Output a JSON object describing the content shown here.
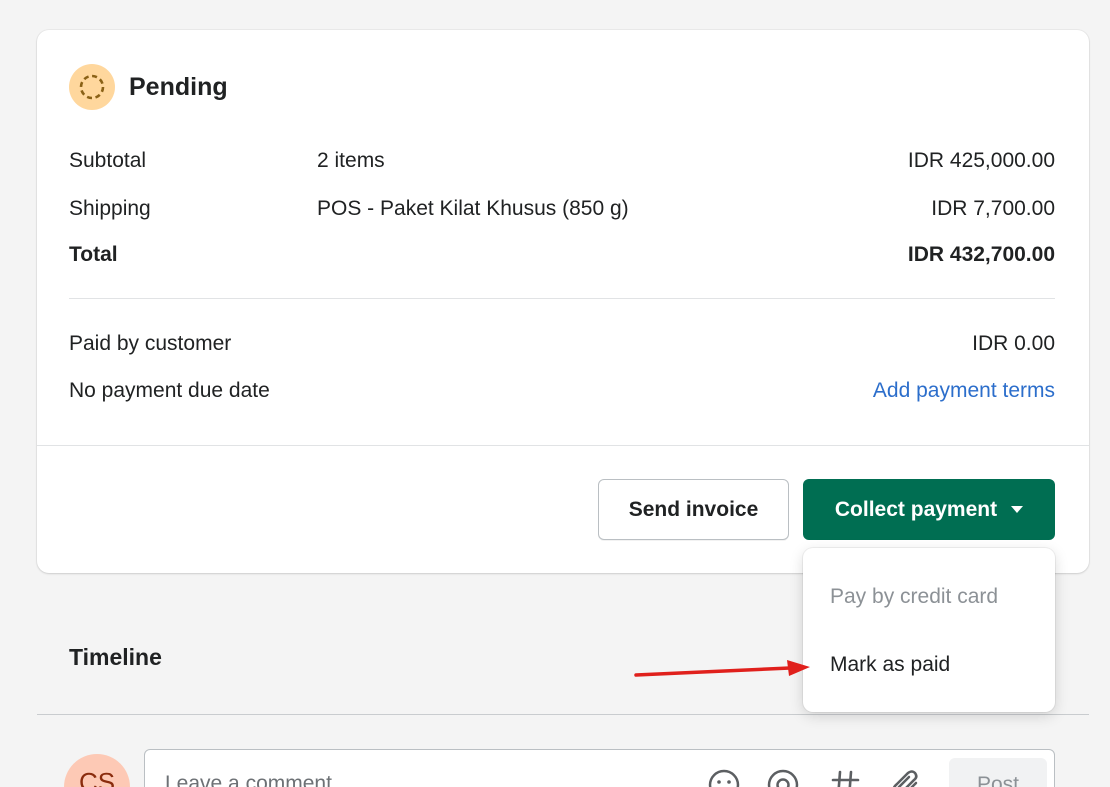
{
  "status": {
    "label": "Pending",
    "icon": "pending-circle-icon"
  },
  "summary": {
    "subtotal": {
      "label": "Subtotal",
      "desc": "2 items",
      "amount": "IDR 425,000.00"
    },
    "shipping": {
      "label": "Shipping",
      "desc": "POS - Paket Kilat Khusus (850 g)",
      "amount": "IDR 7,700.00"
    },
    "total": {
      "label": "Total",
      "amount": "IDR 432,700.00"
    }
  },
  "payment": {
    "paid": {
      "label": "Paid by customer",
      "amount": "IDR 0.00"
    },
    "due": {
      "label": "No payment due date",
      "link": "Add payment terms"
    }
  },
  "actions": {
    "send_invoice": "Send invoice",
    "collect_payment": "Collect payment"
  },
  "dropdown": {
    "items": [
      {
        "label": "Pay by credit card",
        "disabled": true
      },
      {
        "label": "Mark as paid",
        "disabled": false
      }
    ]
  },
  "timeline": {
    "title": "Timeline",
    "avatar_initials": "CS",
    "comment_placeholder": "Leave a comment...",
    "post_label": "Post"
  },
  "colors": {
    "primary": "#006e52",
    "link": "#2c6ecb",
    "pending_badge": "#ffd79d",
    "annotation_arrow": "#e0201c"
  }
}
